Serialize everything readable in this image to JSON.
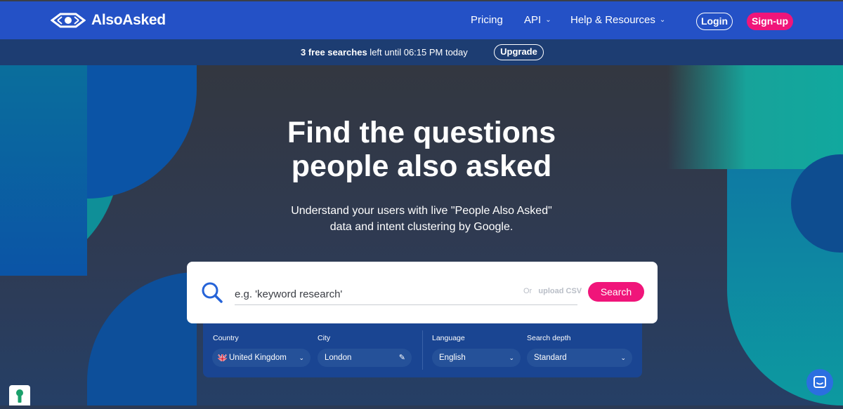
{
  "brand": {
    "name": "AlsoAsked"
  },
  "nav": {
    "pricing": "Pricing",
    "api": "API",
    "help": "Help & Resources",
    "login": "Login",
    "signup": "Sign-up"
  },
  "banner": {
    "count": "3 free searches",
    "rest": " left until 06:15 PM today",
    "upgrade": "Upgrade"
  },
  "hero": {
    "title_line1": "Find the questions",
    "title_line2": "people also asked",
    "subtitle_line1": "Understand your users with live \"People Also Asked\"",
    "subtitle_line2": "data and intent clustering by Google."
  },
  "search": {
    "placeholder": "e.g. 'keyword research'",
    "or": "Or",
    "upload": "upload CSV",
    "button": "Search"
  },
  "filters": {
    "country_label": "Country",
    "country_value": "United Kingdom",
    "city_label": "City",
    "city_value": "London",
    "language_label": "Language",
    "language_value": "English",
    "depth_label": "Search depth",
    "depth_value": "Standard"
  },
  "colors": {
    "primary": "#2451c6",
    "accent": "#f0157a",
    "banner": "#1d3d72",
    "filter_bg": "#1a4592"
  }
}
